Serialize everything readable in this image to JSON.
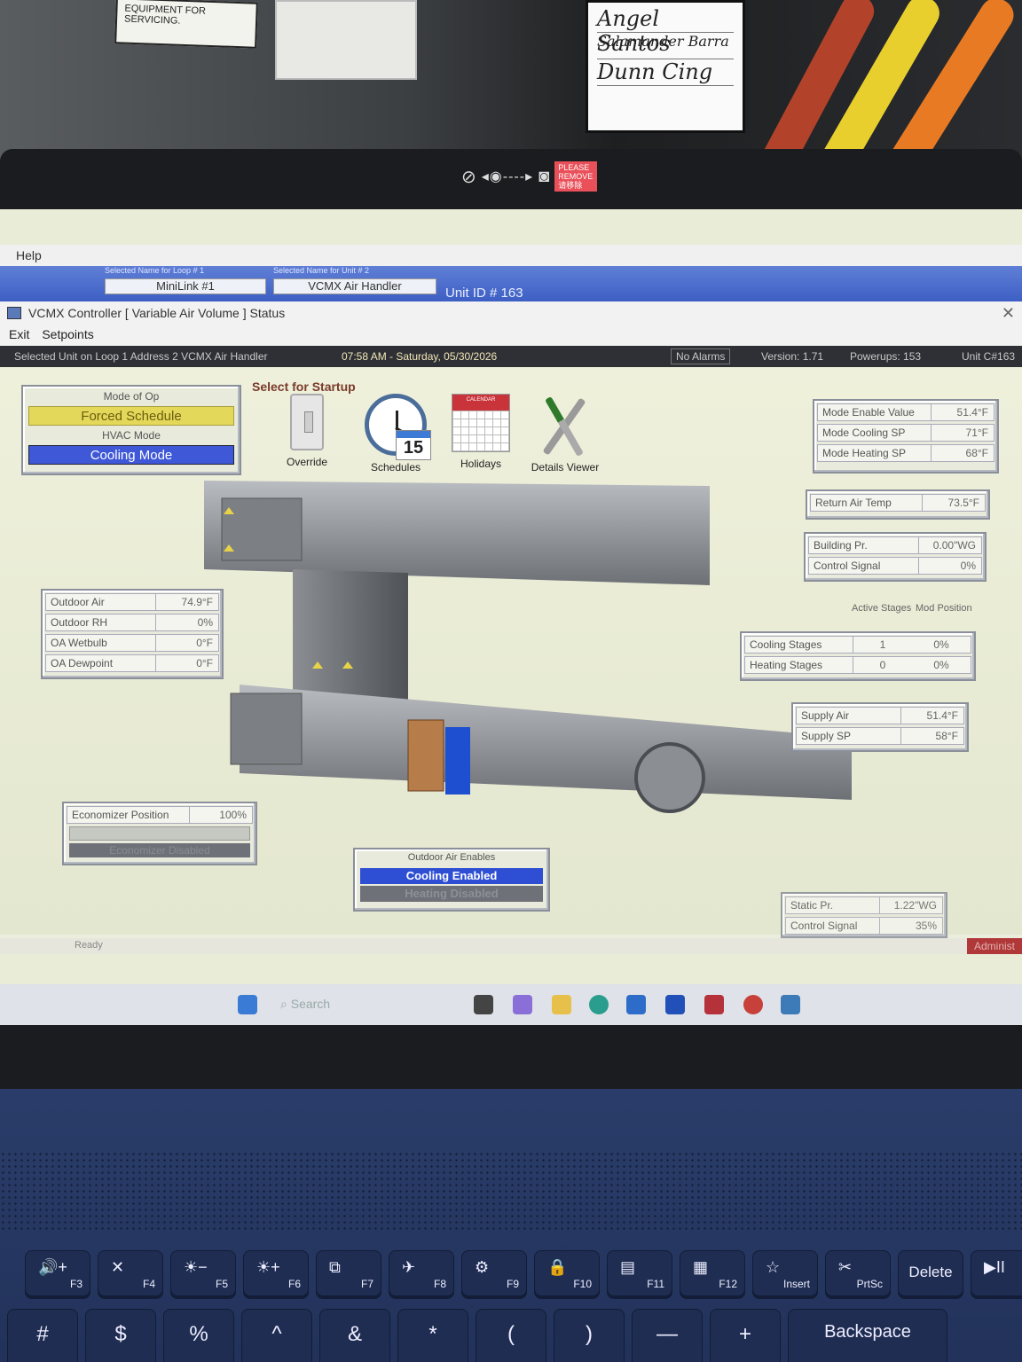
{
  "surroundings": {
    "equipment_label": "EQUIPMENT FOR SERVICING.",
    "sign_lines": [
      "Angel Santos",
      "Salamander Barra",
      "Dunn Cing"
    ],
    "webcam_sticker": "PLEASE REMOVE 请移除"
  },
  "background_app": {
    "menu_help": "Help",
    "loop_caption": "Selected Name for Loop #   1",
    "loop_value": "MiniLink #1",
    "unit_caption": "Selected Name for Unit #   2",
    "unit_value": "VCMX Air Handler",
    "unit_id": "Unit ID # 163"
  },
  "window": {
    "title": "VCMX Controller [ Variable Air Volume ] Status",
    "menu": [
      "Exit",
      "Setpoints"
    ],
    "status": {
      "selected": "Selected Unit on Loop 1 Address 2   VCMX Air Handler",
      "datetime": "07:58 AM   -   Saturday, 05/30/2026",
      "alarms": "No Alarms",
      "version": "Version: 1.71",
      "powerups": "Powerups:   153",
      "unit": "Unit C#163"
    }
  },
  "mode": {
    "mode_caption": "Mode of Op",
    "mode_value": "Forced Schedule",
    "hvac_caption": "HVAC Mode",
    "hvac_value": "Cooling Mode"
  },
  "startup": {
    "title": "Select for Startup",
    "tools": [
      "Override",
      "Schedules",
      "Holidays",
      "Details Viewer"
    ],
    "calendar_day": "15",
    "calendar_header": "CALENDAR"
  },
  "setpoints": [
    {
      "label": "Mode Enable Value",
      "value": "51.4°F"
    },
    {
      "label": "Mode Cooling SP",
      "value": "71°F"
    },
    {
      "label": "Mode Heating SP",
      "value": "68°F"
    }
  ],
  "return_air": {
    "label": "Return Air Temp",
    "value": "73.5°F"
  },
  "building": [
    {
      "label": "Building Pr.",
      "value": "0.00\"WG"
    },
    {
      "label": "Control Signal",
      "value": "0%"
    }
  ],
  "stages": {
    "head_active": "Active Stages",
    "head_mod": "Mod Position",
    "rows": [
      {
        "label": "Cooling Stages",
        "active": "1",
        "mod": "0%"
      },
      {
        "label": "Heating Stages",
        "active": "0",
        "mod": "0%"
      }
    ]
  },
  "supply": [
    {
      "label": "Supply Air",
      "value": "51.4°F"
    },
    {
      "label": "Supply SP",
      "value": "58°F"
    }
  ],
  "outdoor": [
    {
      "label": "Outdoor Air",
      "value": "74.9°F"
    },
    {
      "label": "Outdoor RH",
      "value": "0%"
    },
    {
      "label": "OA Wetbulb",
      "value": "0°F"
    },
    {
      "label": "OA Dewpoint",
      "value": "0°F"
    }
  ],
  "economizer": {
    "label": "Economizer Position",
    "value": "100%",
    "status": "Economizer Disabled"
  },
  "oa_enables": {
    "caption": "Outdoor Air Enables",
    "cooling": "Cooling Enabled",
    "heating": "Heating Disabled"
  },
  "static": [
    {
      "label": "Static Pr.",
      "value": "1.22\"WG"
    },
    {
      "label": "Control Signal",
      "value": "35%"
    }
  ],
  "footer": {
    "ready": "Ready",
    "admin": "Administ"
  },
  "taskbar": {
    "search": "Search"
  },
  "keyboard": {
    "fkeys": [
      {
        "glyph": "🔊+",
        "label": "F3"
      },
      {
        "glyph": "✕",
        "label": "F4"
      },
      {
        "glyph": "☀−",
        "label": "F5"
      },
      {
        "glyph": "☀+",
        "label": "F6"
      },
      {
        "glyph": "⧉",
        "label": "F7"
      },
      {
        "glyph": "✈",
        "label": "F8"
      },
      {
        "glyph": "⚙",
        "label": "F9"
      },
      {
        "glyph": "🔒",
        "label": "F10"
      },
      {
        "glyph": "▤",
        "label": "F11"
      },
      {
        "glyph": "▦",
        "label": "F12"
      },
      {
        "glyph": "☆",
        "label": "Insert"
      },
      {
        "glyph": "✂",
        "label": "PrtSc"
      },
      {
        "glyph": "",
        "label": "Delete"
      },
      {
        "glyph": "▶II",
        "label": ""
      }
    ],
    "numkeys": [
      "#",
      "$",
      "%",
      "^",
      "&",
      "*",
      "(",
      ")",
      "—",
      "+",
      "Backspace"
    ]
  }
}
